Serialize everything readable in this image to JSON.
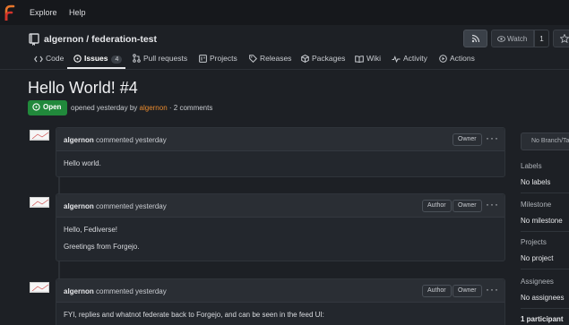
{
  "topnav": {
    "items": [
      "Explore",
      "Help"
    ]
  },
  "repo": {
    "path": "algernon / federation-test",
    "watch_label": "Watch",
    "watch_count": "1"
  },
  "tabs": [
    {
      "label": "Code",
      "icon": "code-icon"
    },
    {
      "label": "Issues",
      "icon": "issue-icon",
      "count": "4",
      "active": true
    },
    {
      "label": "Pull requests",
      "icon": "pull-request-icon"
    },
    {
      "label": "Projects",
      "icon": "project-icon"
    },
    {
      "label": "Releases",
      "icon": "tag-icon"
    },
    {
      "label": "Packages",
      "icon": "package-icon"
    },
    {
      "label": "Wiki",
      "icon": "book-icon"
    },
    {
      "label": "Activity",
      "icon": "pulse-icon"
    },
    {
      "label": "Actions",
      "icon": "play-icon"
    }
  ],
  "issue": {
    "title": "Hello World! #4",
    "status": "Open",
    "meta_prefix": "opened yesterday by",
    "author": "algernon",
    "meta_suffix": "· 2 comments"
  },
  "comments": [
    {
      "author": "algernon",
      "time": "commented yesterday",
      "badges": [
        "Owner"
      ],
      "body": [
        "Hello world."
      ]
    },
    {
      "author": "algernon",
      "time": "commented yesterday",
      "badges": [
        "Author",
        "Owner"
      ],
      "body": [
        "Hello, Fediverse!",
        "Greetings from Forgejo."
      ]
    },
    {
      "author": "algernon",
      "time": "commented yesterday",
      "badges": [
        "Author",
        "Owner"
      ],
      "body": [
        "FYI, replies and whatnot federate back to Forgejo, and can be seen in the feed UI:"
      ]
    }
  ],
  "sidebar": {
    "branch_placeholder": "No Branch/Ta",
    "labels_head": "Labels",
    "labels_val": "No labels",
    "milestone_head": "Milestone",
    "milestone_val": "No milestone",
    "projects_head": "Projects",
    "projects_val": "No project",
    "assignees_head": "Assignees",
    "assignees_val": "No assignees",
    "participants": "1 participant"
  },
  "colors": {
    "accent_open": "#21893b",
    "user_link": "#e98a2e",
    "background": "#1d2025",
    "topnav": "#16181c"
  }
}
